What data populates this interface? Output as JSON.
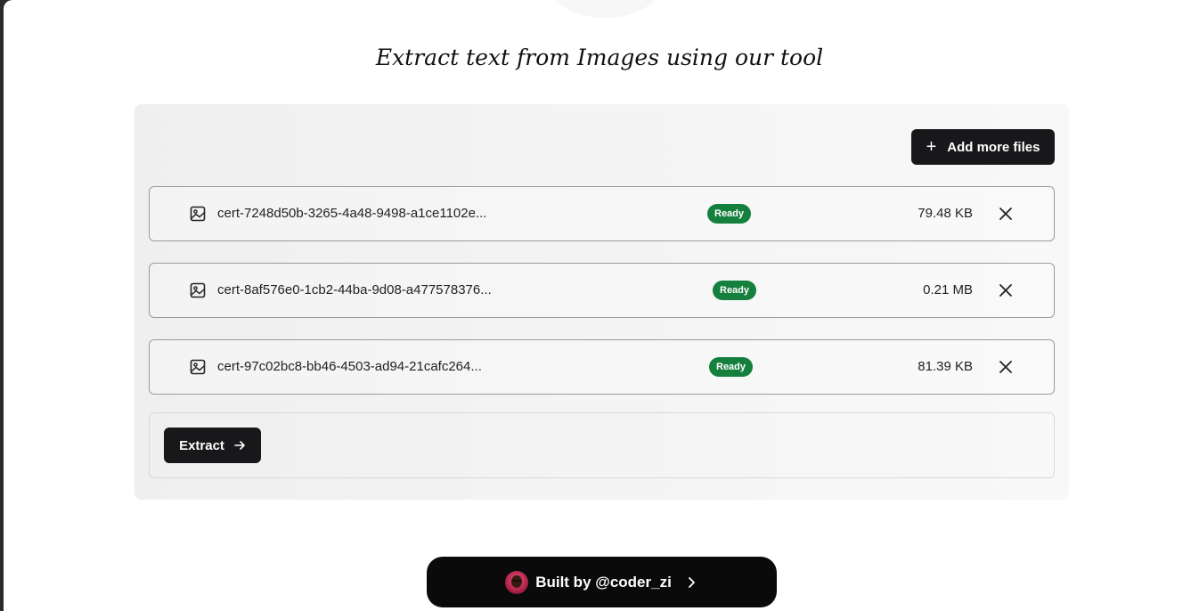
{
  "header": {
    "tagline": "Extract text from Images using our tool"
  },
  "toolbar": {
    "add_more_label": "Add more files",
    "add_icon": "plus-icon"
  },
  "files": [
    {
      "name": "cert-7248d50b-3265-4a48-9498-a1ce1102e...",
      "status": "Ready",
      "size": "79.48 KB"
    },
    {
      "name": "cert-8af576e0-1cb2-44ba-9d08-a477578376...",
      "status": "Ready",
      "size": "0.21 MB"
    },
    {
      "name": "cert-97c02bc8-bb46-4503-ad94-21cafc264...",
      "status": "Ready",
      "size": "81.39 KB"
    }
  ],
  "icons": {
    "file": "image-icon",
    "remove": "close-icon",
    "extract_arrow": "arrow-right-icon",
    "built_chevron": "chevron-right-icon"
  },
  "colors": {
    "ready_badge": "#15803d",
    "button_dark": "#18181b"
  },
  "actions": {
    "extract_label": "Extract"
  },
  "footer": {
    "built_by_label": "Built by @coder_zi"
  }
}
